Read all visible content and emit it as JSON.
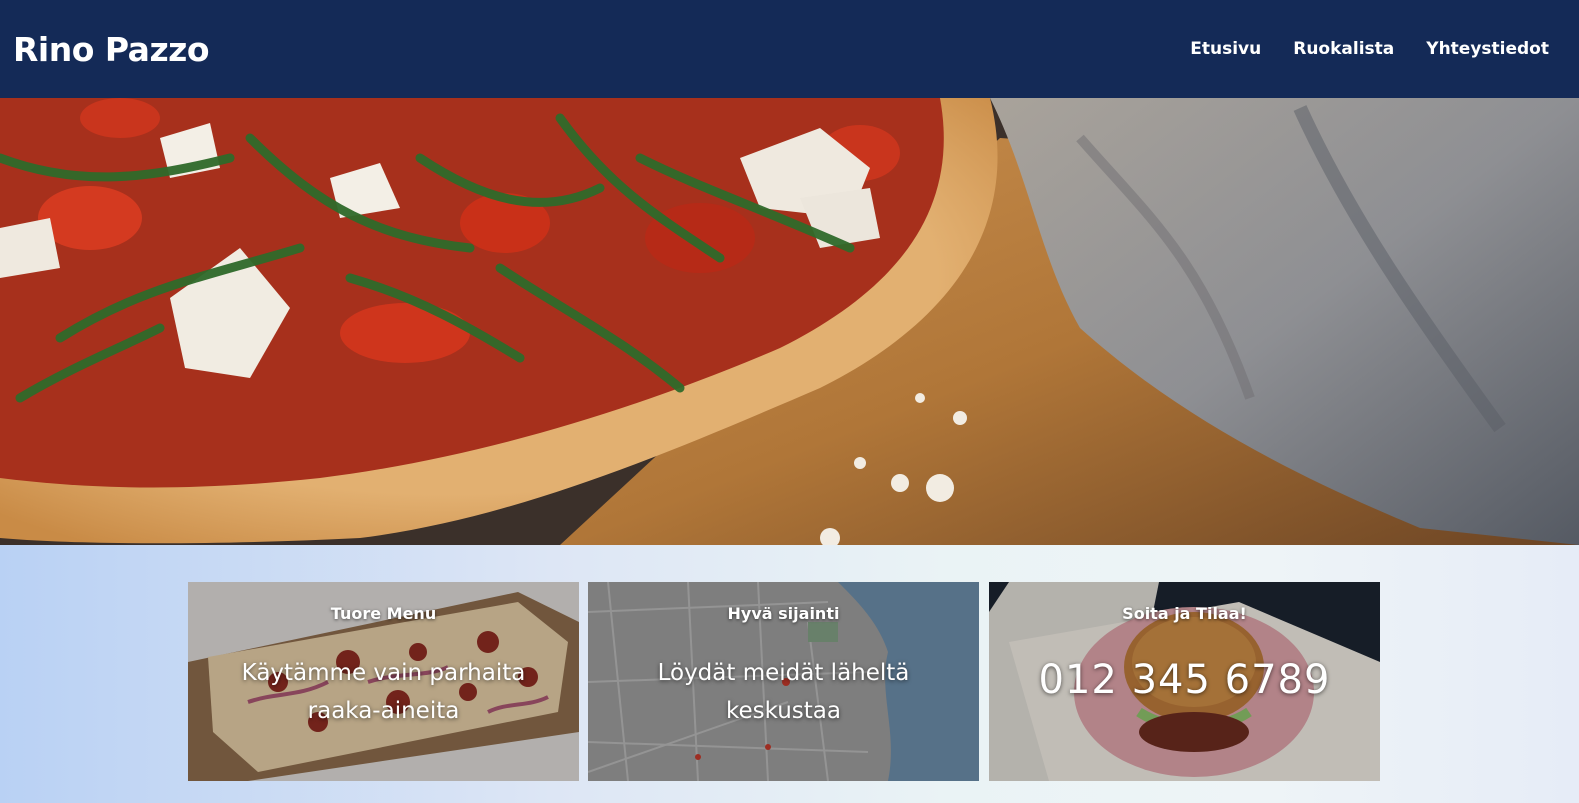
{
  "site": {
    "logo": "Rino Pazzo"
  },
  "nav": {
    "items": [
      {
        "label": "Etusivu"
      },
      {
        "label": "Ruokalista"
      },
      {
        "label": "Yhteystiedot"
      }
    ]
  },
  "hero": {
    "image": "pizza-on-wooden-board-photo"
  },
  "cards": [
    {
      "title": "Tuore Menu",
      "text": "Käytämme vain parhaita raaka-aineita",
      "image": "flatbread-pizza-photo"
    },
    {
      "title": "Hyvä sijainti",
      "text": "Löydät meidät läheltä keskustaa",
      "image": "city-map-image"
    },
    {
      "title": "Soita ja Tilaa!",
      "text": "012 345 6789",
      "image": "burger-in-basket-photo"
    }
  ],
  "colors": {
    "header_bg": "#142a57",
    "text": "#ffffff"
  }
}
